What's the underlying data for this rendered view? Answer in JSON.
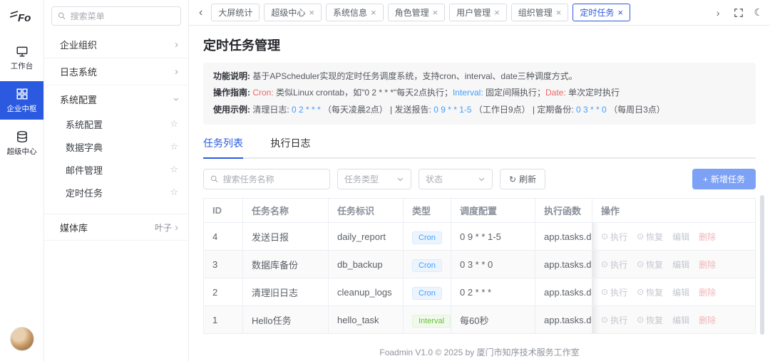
{
  "brand": {
    "logo_text": "Fo"
  },
  "colors": {
    "primary": "#2b5ae0",
    "danger": "#f56c6c",
    "success": "#67c23a",
    "link_blue": "#409eff",
    "add_button": "#7da2f5"
  },
  "icons": {
    "chevron_left": "‹",
    "chevron_right": "›",
    "close": "×",
    "star": "☆",
    "refresh": "↻",
    "plus": "+",
    "play_circle": "⊙",
    "resume_circle": "⊙",
    "moon": "☾"
  },
  "rail": {
    "items": [
      {
        "label": "工作台"
      },
      {
        "label": "企业中枢",
        "active": true
      },
      {
        "label": "超级中心"
      }
    ]
  },
  "sidebar": {
    "search_placeholder": "搜索菜单",
    "groups": [
      {
        "label": "企业组织"
      },
      {
        "label": "日志系统"
      },
      {
        "label": "系统配置",
        "expanded": true,
        "children": [
          {
            "label": "系统配置"
          },
          {
            "label": "数据字典"
          },
          {
            "label": "邮件管理"
          },
          {
            "label": "定时任务"
          }
        ]
      },
      {
        "label": "媒体库",
        "badge": "叶子"
      }
    ]
  },
  "tabbar": {
    "tabs": [
      {
        "label": "大屏统计",
        "closable": false
      },
      {
        "label": "超级中心",
        "closable": true
      },
      {
        "label": "系统信息",
        "closable": true
      },
      {
        "label": "角色管理",
        "closable": true
      },
      {
        "label": "用户管理",
        "closable": true
      },
      {
        "label": "组织管理",
        "closable": true
      },
      {
        "label": "定时任务",
        "closable": true,
        "active": true
      }
    ]
  },
  "page": {
    "title": "定时任务管理",
    "info": {
      "line1": {
        "label": "功能说明:",
        "text": " 基于APScheduler实现的定时任务调度系统，支持cron、interval、date三种调度方式。"
      },
      "line2": {
        "label": "操作指南:",
        "k1": " Cron:",
        "s1": " 类似Linux crontab，如\"0 2 * * *\"每天2点执行；",
        "k2": "Interval:",
        "s2": " 固定间隔执行；",
        "k3": "Date:",
        "s3": " 单次定时执行"
      },
      "line3": {
        "label": "使用示例:",
        "s1": " 清理日志: ",
        "c1": "0 2 * * *",
        "s2": " （每天凌晨2点） | 发送报告: ",
        "c2": "0 9 * * 1-5",
        "s3": " （工作日9点） | 定期备份: ",
        "c3": "0 3 * * 0",
        "s4": " （每周日3点）"
      }
    },
    "tabs": [
      {
        "label": "任务列表",
        "active": true
      },
      {
        "label": "执行日志"
      }
    ],
    "toolbar": {
      "search_placeholder": "搜索任务名称",
      "type_placeholder": "任务类型",
      "status_placeholder": "状态",
      "refresh_label": "刷新",
      "add_label": "新增任务"
    },
    "table": {
      "headers": [
        "ID",
        "任务名称",
        "任务标识",
        "类型",
        "调度配置",
        "执行函数",
        "操作"
      ],
      "rows": [
        {
          "id": "4",
          "name": "发送日报",
          "key": "daily_report",
          "type": "Cron",
          "schedule": "0 9 * * 1-5",
          "func": "app.tasks.demo"
        },
        {
          "id": "3",
          "name": "数据库备份",
          "key": "db_backup",
          "type": "Cron",
          "schedule": "0 3 * * 0",
          "func": "app.tasks.demo"
        },
        {
          "id": "2",
          "name": "清理旧日志",
          "key": "cleanup_logs",
          "type": "Cron",
          "schedule": "0 2 * * *",
          "func": "app.tasks.demo"
        },
        {
          "id": "1",
          "name": "Hello任务",
          "key": "hello_task",
          "type": "Interval",
          "schedule": "每60秒",
          "func": "app.tasks.demo"
        }
      ],
      "actions": {
        "execute": "执行",
        "resume": "恢复",
        "edit": "编辑",
        "delete": "删除"
      }
    }
  },
  "footer": {
    "text": "Foadmin V1.0 © 2025 by 厦门市知序技术服务工作室"
  }
}
